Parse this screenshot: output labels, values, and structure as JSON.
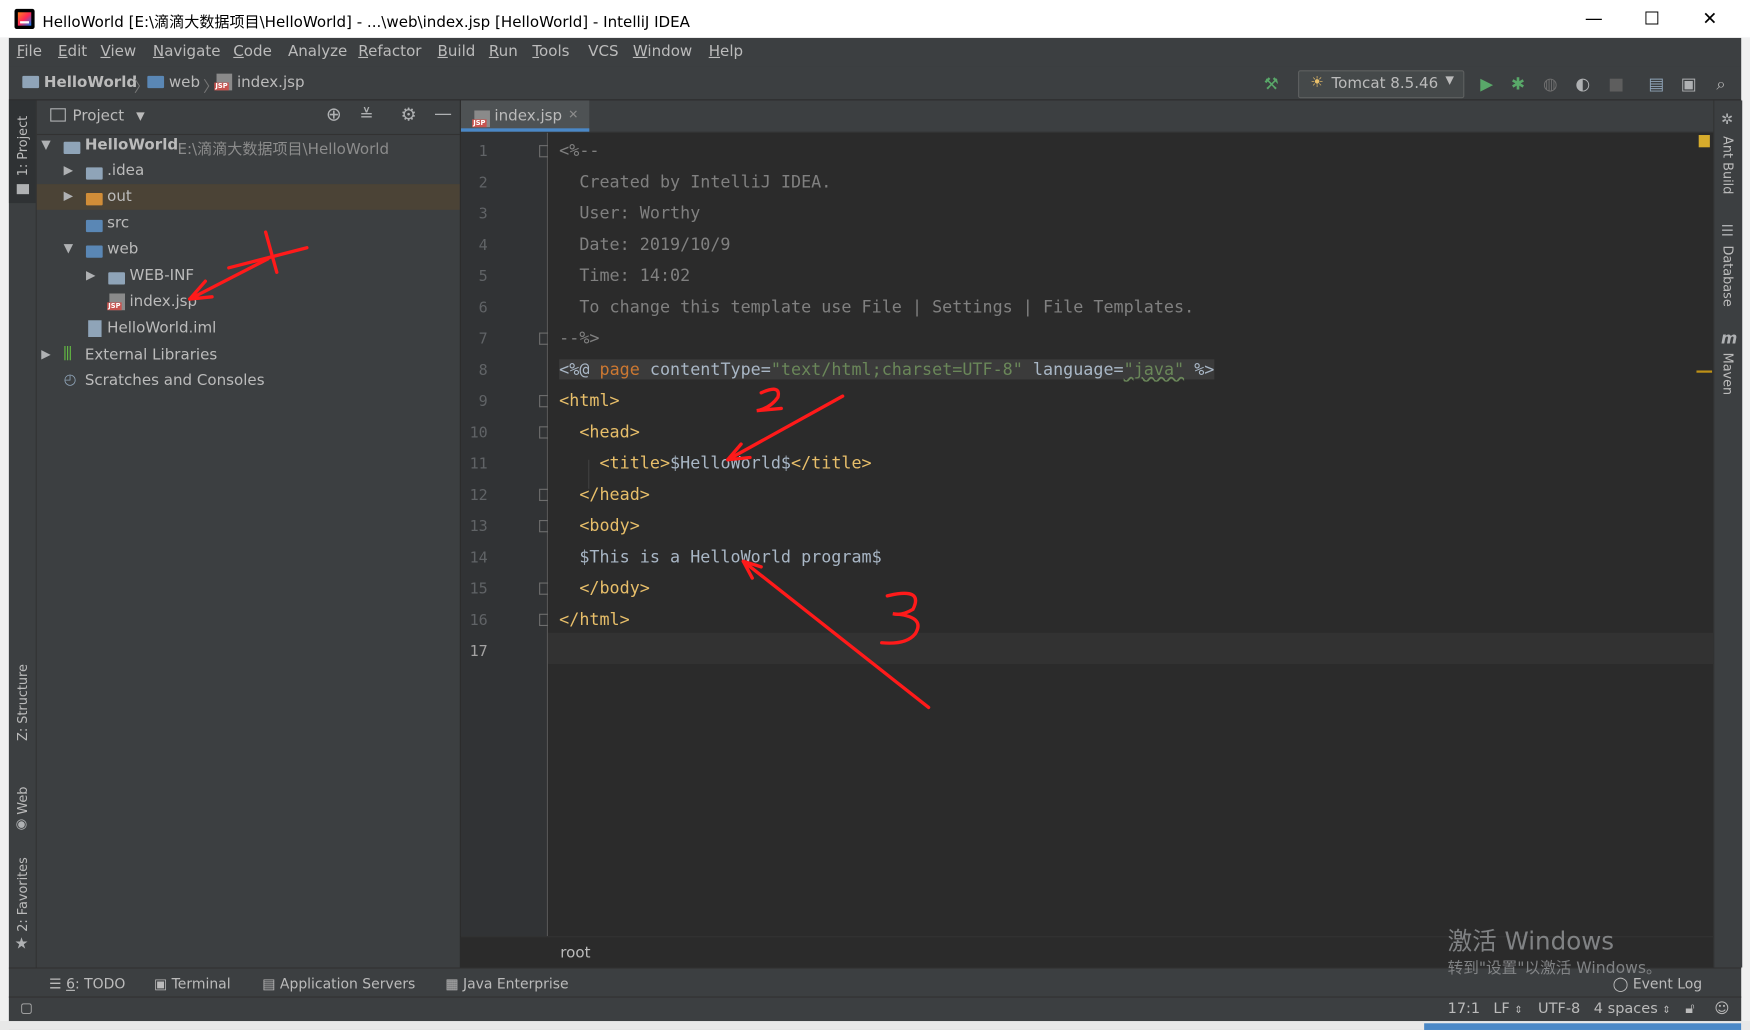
{
  "window": {
    "title": "HelloWorld [E:\\滴滴大数据项目\\HelloWorld] - ...\\web\\index.jsp [HelloWorld] - IntelliJ IDEA",
    "minimize": "—",
    "maximize": "☐",
    "close": "✕"
  },
  "menu": [
    {
      "u": "F",
      "rest": "ile"
    },
    {
      "u": "E",
      "rest": "dit"
    },
    {
      "u": "V",
      "rest": "iew"
    },
    {
      "u": "N",
      "rest": "avigate"
    },
    {
      "u": "C",
      "rest": "ode"
    },
    {
      "u": "",
      "rest": "Analyze"
    },
    {
      "u": "R",
      "rest": "efactor"
    },
    {
      "u": "B",
      "rest": "uild"
    },
    {
      "u": "R",
      "rest": "un"
    },
    {
      "u": "T",
      "rest": "ools"
    },
    {
      "u": "",
      "rest": "VCS"
    },
    {
      "u": "W",
      "rest": "indow"
    },
    {
      "u": "H",
      "rest": "elp"
    }
  ],
  "navbar": {
    "crumb_project": "HelloWorld",
    "crumb_folder": "web",
    "crumb_file": "index.jsp",
    "run_config": "Tomcat 8.5.46"
  },
  "left_tabs": {
    "project": "1: Project",
    "structure": "Z: Structure",
    "web": "Web",
    "favorites": "2: Favorites"
  },
  "right_tabs": {
    "ant": "Ant Build",
    "database": "Database",
    "maven": "Maven"
  },
  "project_panel": {
    "header": "Project",
    "tree": [
      {
        "label": "HelloWorld",
        "path": "E:\\滴滴大数据项目\\HelloWorld"
      },
      {
        "label": ".idea"
      },
      {
        "label": "out"
      },
      {
        "label": "src"
      },
      {
        "label": "web"
      },
      {
        "label": "WEB-INF"
      },
      {
        "label": "index.jsp"
      },
      {
        "label": "HelloWorld.iml"
      },
      {
        "label": "External Libraries"
      },
      {
        "label": "Scratches and Consoles"
      }
    ]
  },
  "editor": {
    "tab": "index.jsp",
    "line_numbers": [
      "1",
      "2",
      "3",
      "4",
      "5",
      "6",
      "7",
      "8",
      "9",
      "10",
      "11",
      "12",
      "13",
      "14",
      "15",
      "16",
      "17"
    ],
    "lines": {
      "l1": "<%--",
      "l2": "  Created by IntelliJ IDEA.",
      "l3": "  User: Worthy",
      "l4": "  Date: 2019/10/9",
      "l5": "  Time: 14:02",
      "l6": "  To change this template use File | Settings | File Templates.",
      "l7": "--%>",
      "l8_a": "<%@ ",
      "l8_b": "page",
      "l8_c": " contentType=",
      "l8_d": "\"text/html;charset=UTF-8\"",
      "l8_e": " language=",
      "l8_f": "\"java\"",
      "l8_g": " %>",
      "l9": "<html>",
      "l10": "  <head>",
      "l11_a": "    <title>",
      "l11_b": "$HelloWorld$",
      "l11_c": "</title>",
      "l12": "  </head>",
      "l13": "  <body>",
      "l14": "  $This is a HelloWorld program$",
      "l15": "  </body>",
      "l16": "</html>"
    },
    "breadcrumb": "root"
  },
  "annotations": {
    "n1": "1",
    "n2": "2",
    "n3": "3"
  },
  "bottom_tools": {
    "todo_u": "6",
    "todo": ": TODO",
    "terminal": "Terminal",
    "app_servers": "Application Servers",
    "java_ee": "Java Enterprise",
    "event_log": "Event Log"
  },
  "status": {
    "position": "17:1",
    "line_sep": "LF",
    "encoding": "UTF-8",
    "indent": "4 spaces"
  },
  "watermark": {
    "line1": "激活 Windows",
    "line2": "转到\"设置\"以激活 Windows。"
  },
  "colors": {
    "accent": "#4a88c7",
    "tag": "#e8bf6a",
    "string": "#6a8759",
    "keyword": "#cc7832",
    "annotation_red": "#ff1a1a"
  }
}
